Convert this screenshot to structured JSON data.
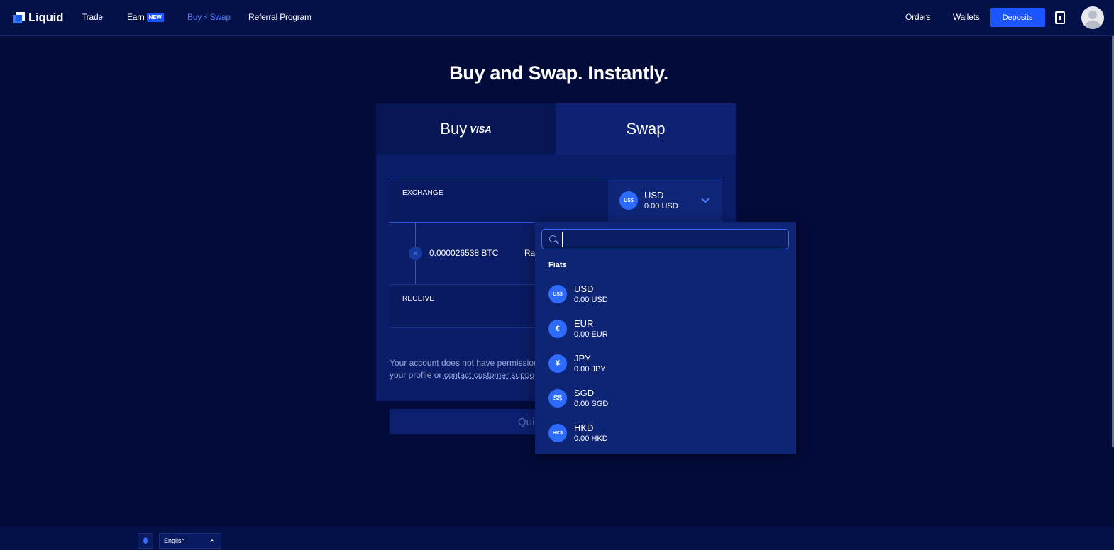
{
  "nav": {
    "logo": "Liquid",
    "links": {
      "trade": "Trade",
      "earn": "Earn",
      "earn_badge": "NEW",
      "buy": "Buy",
      "swap": "Swap",
      "referral": "Referral Program"
    },
    "orders": "Orders",
    "wallets": "Wallets",
    "deposits": "Deposits"
  },
  "page": {
    "title": "Buy and Swap. Instantly."
  },
  "tabs": {
    "buy": "Buy",
    "buy_badge": "VISA",
    "swap": "Swap"
  },
  "exchange": {
    "label": "EXCHANGE",
    "currency": {
      "icon": "US$",
      "code": "USD",
      "balance": "0.00 USD"
    }
  },
  "rate": {
    "value": "0.000026538 BTC",
    "label": "Ra"
  },
  "receive": {
    "label": "RECEIVE"
  },
  "notice": {
    "line1": "Your account does not have permission",
    "line2_prefix": "your profile or ",
    "line2_link": "contact customer suppo"
  },
  "quote_button": "Qui",
  "dropdown": {
    "search_value": "",
    "section": "Fiats",
    "items": [
      {
        "icon": "US$",
        "code": "USD",
        "balance": "0.00 USD"
      },
      {
        "icon": "€",
        "code": "EUR",
        "balance": "0.00 EUR"
      },
      {
        "icon": "¥",
        "code": "JPY",
        "balance": "0.00 JPY"
      },
      {
        "icon": "S$",
        "code": "SGD",
        "balance": "0.00 SGD"
      },
      {
        "icon": "HK$",
        "code": "HKD",
        "balance": "0.00 HKD"
      }
    ]
  },
  "footer": {
    "language": "English"
  },
  "colors": {
    "background": "#030b3a",
    "accent": "#1a55ff",
    "card": "#0b1d68"
  }
}
